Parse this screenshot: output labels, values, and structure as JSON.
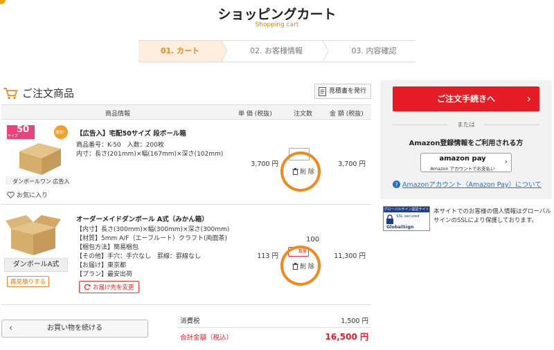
{
  "header": {
    "title": "ショッピングカート",
    "subtitle": "Shopping cart"
  },
  "steps": [
    {
      "label": "01. カート",
      "active": true
    },
    {
      "label": "02. お客様情報",
      "active": false
    },
    {
      "label": "03. 内容確認",
      "active": false
    }
  ],
  "section": {
    "title": "ご注文商品",
    "quote_button": "見積書を発行"
  },
  "table_headers": {
    "product": "商品情報",
    "unit_price": "単 価 (税抜)",
    "qty": "注文数",
    "amount": "金 額 (税抜)"
  },
  "items": [
    {
      "image_badge_number": "50",
      "image_badge_sub": "サイズ",
      "image_badge_round": "激安!",
      "image_caption": "ダンボールワン 広告入",
      "name": "【広告入】宅配50サイズ 段ボール箱",
      "lines": [
        "商品番号：K-50　入数：200枚",
        "内寸：長さ(201mm)×幅(167mm)×深さ(102mm)"
      ],
      "unit_price": "3,700 円",
      "qty": "",
      "delete_label": "削 除",
      "amount": "3,700 円",
      "favorite_label": "お気に入り"
    },
    {
      "image_caption": "ダンボールA式",
      "reorder_label": "再見積りする",
      "name": "オーダーメイドダンボール A式（みかん箱）",
      "lines": [
        "【内寸】長さ(300mm)×幅(300mm)×深さ(300mm)",
        "【材質】5mm A/F（エーフルート）クラフト(両面茶)",
        "【梱包方法】簡易梱包",
        "【その他】手穴：手穴なし　罫線：罫線なし",
        "【お届け】東京都",
        "【プラン】最安出荷"
      ],
      "change_dest_label": "お届け先を変更",
      "unit_price": "113 円",
      "qty": "100",
      "qty_tag": "数量",
      "delete_label": "削 除",
      "amount": "11,300 円"
    }
  ],
  "totals": {
    "tax_label": "消費税",
    "tax_value": "1,500 円",
    "total_label": "合計金額（税込）",
    "total_value": "16,500 円"
  },
  "continue_button": "お買い物を続ける",
  "sidebar": {
    "order_button": "ご注文手続きへ",
    "or_text": "または",
    "amazon_title": "Amazon登録情報をご利用される方",
    "amazon_button_l1": "amazon pay",
    "amazon_button_l2": "Amazon アカウントでお支払い",
    "amazon_link": "Amazonアカウント（Amazon Pay）について"
  },
  "globalsign": {
    "badge_title": "グローバルサイン認証サイト",
    "badge_sub": "SSL secured",
    "badge_brand": "GlobalSign",
    "text": "本サイトでのお客様の個人情報はグローバルサインのSSLにより保護しております。"
  },
  "colors": {
    "accent_orange": "#f08a1c",
    "order_red": "#e51c23",
    "link_blue": "#1a73c8",
    "total_red": "#e51c23"
  }
}
